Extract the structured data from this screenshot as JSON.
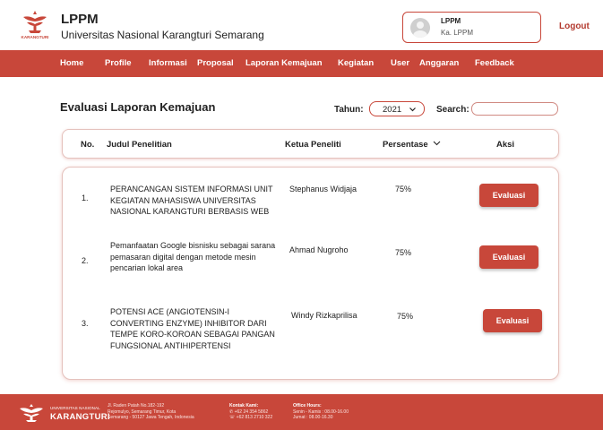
{
  "header": {
    "title": "LPPM",
    "subtitle": "Universitas Nasional Karangturi Semarang",
    "user_name": "LPPM",
    "user_role": "Ka. LPPM",
    "logout_label": "Logout",
    "logo_text": "KARANGTURI"
  },
  "nav": {
    "items": [
      "Home",
      "Profile",
      "Informasi",
      "Proposal",
      "Laporan Kemajuan",
      "Kegiatan",
      "User",
      "Anggaran",
      "Feedback"
    ]
  },
  "main": {
    "page_title": "Evaluasi Laporan Kemajuan",
    "year_label": "Tahun:",
    "year_value": "2021",
    "search_label": "Search:",
    "search_value": "",
    "columns": {
      "no": "No.",
      "judul": "Judul Penelitian",
      "ketua": "Ketua Peneliti",
      "persentase": "Persentase",
      "aksi": "Aksi"
    },
    "rows": [
      {
        "no": "1.",
        "judul": "PERANCANGAN SISTEM INFORMASI UNIT KEGIATAN MAHASISWA UNIVERSITAS NASIONAL KARANGTURI BERBASIS WEB",
        "ketua": "Stephanus Widjaja",
        "persentase": "75%",
        "action": "Evaluasi"
      },
      {
        "no": "2.",
        "judul": "Pemanfaatan Google bisnisku sebagai sarana pemasaran digital dengan metode mesin pencarian lokal area",
        "ketua": "Ahmad Nugroho",
        "persentase": "75%",
        "action": "Evaluasi"
      },
      {
        "no": "3.",
        "judul": "POTENSI ACE (ANGIOTENSIN-I CONVERTING ENZYME) INHIBITOR DARI TEMPE KORO-KOROAN SEBAGAI PANGAN FUNGSIONAL ANTIHIPERTENSI",
        "ketua": "Windy Rizkaprilisa",
        "persentase": "75%",
        "action": "Evaluasi"
      }
    ]
  },
  "footer": {
    "uni_small": "UNIVERSITAS NASIONAL",
    "uni_big": "KARANGTURI",
    "address_lines": [
      "Jl. Raden Patah No.182-192",
      "Rejomulyo, Semarang Timur, Kota",
      "Semarang - 50127 Jawa Tengah, Indonesia"
    ],
    "contact_title": "Kontak Kami:",
    "contact_lines": [
      "+62 24 354 5862",
      "+62 813 2710 322"
    ],
    "office_title": "Office Hours:",
    "office_lines": [
      "Senin - Kamis : 08.00-16.00",
      "Jumat : 08.00-16.30"
    ]
  },
  "colors": {
    "brand": "#c8473a",
    "text": "#222222"
  },
  "icons": {
    "year_dropdown": "chevron-down-icon",
    "sort": "chevron-down-icon",
    "avatar": "user-icon",
    "phone": "phone-icon",
    "whatsapp": "whatsapp-icon"
  }
}
